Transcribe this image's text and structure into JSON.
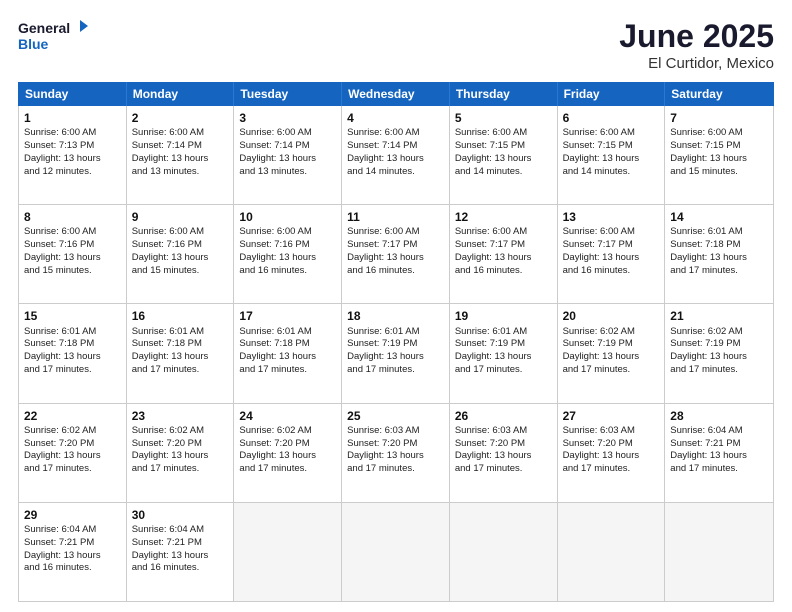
{
  "logo": {
    "line1": "General",
    "line2": "Blue"
  },
  "title": "June 2025",
  "subtitle": "El Curtidor, Mexico",
  "headers": [
    "Sunday",
    "Monday",
    "Tuesday",
    "Wednesday",
    "Thursday",
    "Friday",
    "Saturday"
  ],
  "rows": [
    [
      {
        "day": "",
        "info": ""
      },
      {
        "day": "2",
        "info": "Sunrise: 6:00 AM\nSunset: 7:14 PM\nDaylight: 13 hours\nand 13 minutes."
      },
      {
        "day": "3",
        "info": "Sunrise: 6:00 AM\nSunset: 7:14 PM\nDaylight: 13 hours\nand 13 minutes."
      },
      {
        "day": "4",
        "info": "Sunrise: 6:00 AM\nSunset: 7:14 PM\nDaylight: 13 hours\nand 14 minutes."
      },
      {
        "day": "5",
        "info": "Sunrise: 6:00 AM\nSunset: 7:15 PM\nDaylight: 13 hours\nand 14 minutes."
      },
      {
        "day": "6",
        "info": "Sunrise: 6:00 AM\nSunset: 7:15 PM\nDaylight: 13 hours\nand 14 minutes."
      },
      {
        "day": "7",
        "info": "Sunrise: 6:00 AM\nSunset: 7:15 PM\nDaylight: 13 hours\nand 15 minutes."
      }
    ],
    [
      {
        "day": "1",
        "info": "Sunrise: 6:00 AM\nSunset: 7:13 PM\nDaylight: 13 hours\nand 12 minutes."
      },
      {
        "day": "",
        "info": ""
      },
      {
        "day": "",
        "info": ""
      },
      {
        "day": "",
        "info": ""
      },
      {
        "day": "",
        "info": ""
      },
      {
        "day": "",
        "info": ""
      },
      {
        "day": ""
      }
    ],
    [
      {
        "day": "8",
        "info": "Sunrise: 6:00 AM\nSunset: 7:16 PM\nDaylight: 13 hours\nand 15 minutes."
      },
      {
        "day": "9",
        "info": "Sunrise: 6:00 AM\nSunset: 7:16 PM\nDaylight: 13 hours\nand 15 minutes."
      },
      {
        "day": "10",
        "info": "Sunrise: 6:00 AM\nSunset: 7:16 PM\nDaylight: 13 hours\nand 16 minutes."
      },
      {
        "day": "11",
        "info": "Sunrise: 6:00 AM\nSunset: 7:17 PM\nDaylight: 13 hours\nand 16 minutes."
      },
      {
        "day": "12",
        "info": "Sunrise: 6:00 AM\nSunset: 7:17 PM\nDaylight: 13 hours\nand 16 minutes."
      },
      {
        "day": "13",
        "info": "Sunrise: 6:00 AM\nSunset: 7:17 PM\nDaylight: 13 hours\nand 16 minutes."
      },
      {
        "day": "14",
        "info": "Sunrise: 6:01 AM\nSunset: 7:18 PM\nDaylight: 13 hours\nand 17 minutes."
      }
    ],
    [
      {
        "day": "15",
        "info": "Sunrise: 6:01 AM\nSunset: 7:18 PM\nDaylight: 13 hours\nand 17 minutes."
      },
      {
        "day": "16",
        "info": "Sunrise: 6:01 AM\nSunset: 7:18 PM\nDaylight: 13 hours\nand 17 minutes."
      },
      {
        "day": "17",
        "info": "Sunrise: 6:01 AM\nSunset: 7:18 PM\nDaylight: 13 hours\nand 17 minutes."
      },
      {
        "day": "18",
        "info": "Sunrise: 6:01 AM\nSunset: 7:19 PM\nDaylight: 13 hours\nand 17 minutes."
      },
      {
        "day": "19",
        "info": "Sunrise: 6:01 AM\nSunset: 7:19 PM\nDaylight: 13 hours\nand 17 minutes."
      },
      {
        "day": "20",
        "info": "Sunrise: 6:02 AM\nSunset: 7:19 PM\nDaylight: 13 hours\nand 17 minutes."
      },
      {
        "day": "21",
        "info": "Sunrise: 6:02 AM\nSunset: 7:19 PM\nDaylight: 13 hours\nand 17 minutes."
      }
    ],
    [
      {
        "day": "22",
        "info": "Sunrise: 6:02 AM\nSunset: 7:20 PM\nDaylight: 13 hours\nand 17 minutes."
      },
      {
        "day": "23",
        "info": "Sunrise: 6:02 AM\nSunset: 7:20 PM\nDaylight: 13 hours\nand 17 minutes."
      },
      {
        "day": "24",
        "info": "Sunrise: 6:02 AM\nSunset: 7:20 PM\nDaylight: 13 hours\nand 17 minutes."
      },
      {
        "day": "25",
        "info": "Sunrise: 6:03 AM\nSunset: 7:20 PM\nDaylight: 13 hours\nand 17 minutes."
      },
      {
        "day": "26",
        "info": "Sunrise: 6:03 AM\nSunset: 7:20 PM\nDaylight: 13 hours\nand 17 minutes."
      },
      {
        "day": "27",
        "info": "Sunrise: 6:03 AM\nSunset: 7:20 PM\nDaylight: 13 hours\nand 17 minutes."
      },
      {
        "day": "28",
        "info": "Sunrise: 6:04 AM\nSunset: 7:21 PM\nDaylight: 13 hours\nand 17 minutes."
      }
    ],
    [
      {
        "day": "29",
        "info": "Sunrise: 6:04 AM\nSunset: 7:21 PM\nDaylight: 13 hours\nand 16 minutes."
      },
      {
        "day": "30",
        "info": "Sunrise: 6:04 AM\nSunset: 7:21 PM\nDaylight: 13 hours\nand 16 minutes."
      },
      {
        "day": "",
        "info": ""
      },
      {
        "day": "",
        "info": ""
      },
      {
        "day": "",
        "info": ""
      },
      {
        "day": "",
        "info": ""
      },
      {
        "day": "",
        "info": ""
      }
    ]
  ],
  "row1_special": [
    {
      "day": "1",
      "info": "Sunrise: 6:00 AM\nSunset: 7:13 PM\nDaylight: 13 hours\nand 12 minutes."
    },
    {
      "day": "2",
      "info": "Sunrise: 6:00 AM\nSunset: 7:14 PM\nDaylight: 13 hours\nand 13 minutes."
    },
    {
      "day": "3",
      "info": "Sunrise: 6:00 AM\nSunset: 7:14 PM\nDaylight: 13 hours\nand 13 minutes."
    },
    {
      "day": "4",
      "info": "Sunrise: 6:00 AM\nSunset: 7:14 PM\nDaylight: 13 hours\nand 14 minutes."
    },
    {
      "day": "5",
      "info": "Sunrise: 6:00 AM\nSunset: 7:15 PM\nDaylight: 13 hours\nand 14 minutes."
    },
    {
      "day": "6",
      "info": "Sunrise: 6:00 AM\nSunset: 7:15 PM\nDaylight: 13 hours\nand 14 minutes."
    },
    {
      "day": "7",
      "info": "Sunrise: 6:00 AM\nSunset: 7:15 PM\nDaylight: 13 hours\nand 15 minutes."
    }
  ]
}
